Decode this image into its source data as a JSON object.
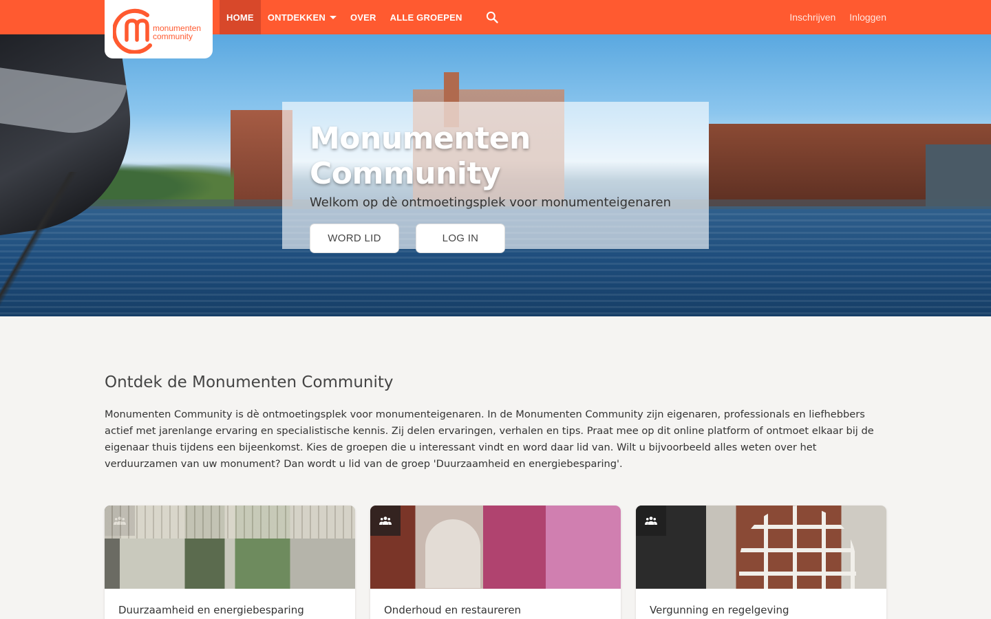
{
  "brand": {
    "logo_line1": "monumenten",
    "logo_line2": "community",
    "accent_color": "#ff5a30"
  },
  "nav": {
    "items": [
      {
        "label": "HOME",
        "active": true
      },
      {
        "label": "ONTDEKKEN",
        "dropdown": true
      },
      {
        "label": "OVER"
      },
      {
        "label": "ALLE GROEPEN"
      }
    ],
    "search_icon": "search-icon",
    "register": "Inschrijven",
    "login": "Inloggen"
  },
  "hero": {
    "title": "Monumenten Community",
    "subtitle": "Welkom op dè ontmoetingsplek voor monumenteigenaren",
    "join_button": "WORD LID",
    "login_button": "LOG IN"
  },
  "main": {
    "section_title": "Ontdek de Monumenten Community",
    "intro": "Monumenten Community is dè ontmoetingsplek voor monumenteigenaren. In de Monumenten Community zijn eigenaren, professionals en liefhebbers actief met jarenlange ervaring en specialistische kennis. Zij delen ervaringen, verhalen en tips. Praat mee op dit online platform of ontmoet elkaar bij de eigenaar thuis tijdens een bijeenkomst. Kies de groepen die u interessant vindt en word daar lid van. Wilt u bijvoorbeeld alles weten over het verduurzamen van uw monument? Dan wordt u lid van de groep 'Duurzaamheid en energiebesparing'.",
    "cards": [
      {
        "title": "Duurzaamheid en energiebesparing",
        "icon": "group-icon"
      },
      {
        "title": "Onderhoud en restaureren",
        "icon": "group-icon"
      },
      {
        "title": "Vergunning en regelgeving",
        "icon": "group-icon"
      }
    ]
  }
}
